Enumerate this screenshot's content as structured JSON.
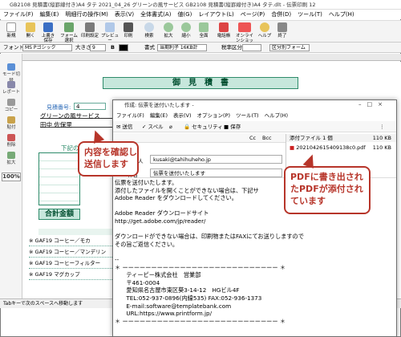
{
  "app": {
    "title": "GB2108 見積書(縦罫線付き)A4 タテ 2021_04_26 グリーンの風サービス GB2108 見積書(縦罫線付き)A4 タテ.dlt - 伝票印刷 12",
    "menu": [
      "ファイル(F)",
      "編集(E)",
      "明細行の操作(M)",
      "表示(V)",
      "全体書式(A)",
      "値(G)",
      "レイアウト(L)",
      "ページ(P)",
      "合併(D)",
      "ツール(T)",
      "ヘルプ(H)"
    ],
    "toolbar": [
      "新規",
      "開く",
      "上書き保存",
      "フォーム選択",
      "印刷設定",
      "プレビュー",
      "印刷",
      "検索",
      "拡大",
      "縮小",
      "全面",
      "電話帳",
      "オンラインショップ",
      "ヘルプ",
      "終了"
    ],
    "font_label": "フォント名",
    "font_value": "MS Pゴシック",
    "size_label": "大きさ",
    "size_value": "9",
    "format_label": "書式",
    "format_value": "当期利子 16KB計",
    "tax_label": "税率区分",
    "section_label": "区分別フォーム",
    "side_panel": [
      "モード切替",
      "レポート",
      "コピー",
      "貼付",
      "削除",
      "拡大",
      "100%"
    ],
    "status": "Tabキーで次のスペースへ移動します"
  },
  "document": {
    "heading": "御　見　積　書",
    "estimate_no_label": "見積番号:",
    "estimate_no": "4",
    "customer": "グリーンの風サービス",
    "person": "田中 佐保里",
    "subject_prefix": "下記の",
    "total_label": "合計金額",
    "rows": [
      "GAF19 コーヒー／モカ",
      "GAF19 コーヒー／マンデリン",
      "GAF19 コーヒーフィルター",
      "GAF19 マグカップ"
    ],
    "row_mark": "※"
  },
  "mail": {
    "title": "作成: 伝票を送付いたします -",
    "menu": [
      "ファイル(F)",
      "編集(E)",
      "表示(V)",
      "オプション(P)",
      "ツール(T)",
      "ヘルプ(H)"
    ],
    "send_label": "送信",
    "spell_label": "スペル",
    "security_label": "セキュリティ",
    "save_label": "保存",
    "fmt_cc": "Cc",
    "fmt_bcc": "Bcc",
    "from_label": "差出人",
    "from_value": "kusaki@tahihuheho.jp",
    "subject_label": "件名",
    "subject_value": "伝票を送付いたします",
    "attach_header": "添付ファイル 1 個",
    "attach_size_header": "110 KB",
    "attach_file": "2021042615409138c0.pdf",
    "attach_size": "110 KB",
    "body": "伝票を送付いたします。\n添付したファイルを開くことができない場合は、下記サ\nAdobe Reader をダウンロードしてください。\n\nAdobe Reader ダウンロードサイト\nhttp://get.adobe.com/jp/reader/\n\nダウンロードができない場合は、印刷物またはFAXにてお送りしますので\nその旨ご返信ください。\n\n--\n＊ ーーーーーーーーーーーーーーーーーーーーーーーーーーー ＊\n　　ティーピー株式会社　営業部\n　　〒461-0004\n　　愛知県名古屋市東区葵3-14-12　HGビル4F\n　　TEL:052-937-0896(内線535) FAX:052-936-1373\n　　E-mail:software@templatebank.com\n　　URL:https://www.printform.jp/\n＊ ーーーーーーーーーーーーーーーーーーーーーーーーーーー ＊"
  },
  "callouts": {
    "left": "内容を確認し\n送信します",
    "right": "PDFに書き出され\nたPDFが添付され\nています"
  },
  "colors": {
    "accent_green": "#2e8b6a",
    "callout_red": "#b7352a"
  }
}
